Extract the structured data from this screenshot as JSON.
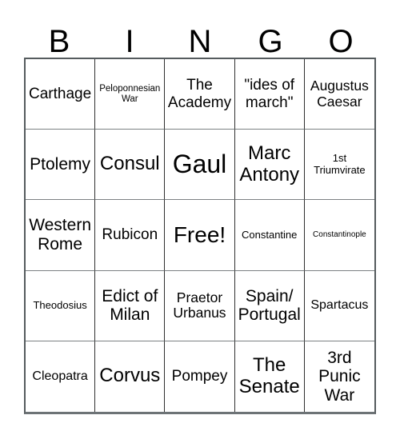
{
  "card": {
    "header_letters": [
      "B",
      "I",
      "N",
      "G",
      "O"
    ],
    "columns": 5,
    "rows": 5,
    "free_space_label": "Free!",
    "free_space_index": 12,
    "grid_border_color": "#555b5e",
    "cell_border_color": "#2f2f2f",
    "background_color": "#ffffff",
    "text_color": "#000000",
    "cells": [
      {
        "label": "Carthage",
        "size": "fs-l"
      },
      {
        "label": "Peloponnesian War",
        "size": "fs-s"
      },
      {
        "label": "The Academy",
        "size": "fs-l"
      },
      {
        "label": "\"ides of march\"",
        "size": "fs-l"
      },
      {
        "label": "Augustus Caesar",
        "size": "fs-ml"
      },
      {
        "label": "Ptolemy",
        "size": "fs-xl"
      },
      {
        "label": "Consul",
        "size": "fs-xxl"
      },
      {
        "label": "Gaul",
        "size": "fs-huge"
      },
      {
        "label": "Marc Antony",
        "size": "fs-xxl"
      },
      {
        "label": "1st Triumvirate",
        "size": "fs-sm"
      },
      {
        "label": "Western Rome",
        "size": "fs-xl"
      },
      {
        "label": "Rubicon",
        "size": "fs-l"
      },
      {
        "label": "Free!",
        "size": "fs-free"
      },
      {
        "label": "Constantine",
        "size": "fs-sm"
      },
      {
        "label": "Constantinople",
        "size": "fs-xs"
      },
      {
        "label": "Theodosius",
        "size": "fs-sm"
      },
      {
        "label": "Edict of Milan",
        "size": "fs-xl"
      },
      {
        "label": "Praetor Urbanus",
        "size": "fs-ml"
      },
      {
        "label": "Spain/ Portugal",
        "size": "fs-xl"
      },
      {
        "label": "Spartacus",
        "size": "fs-m"
      },
      {
        "label": "Cleopatra",
        "size": "fs-m"
      },
      {
        "label": "Corvus",
        "size": "fs-xxl"
      },
      {
        "label": "Pompey",
        "size": "fs-l"
      },
      {
        "label": "The Senate",
        "size": "fs-xxl"
      },
      {
        "label": "3rd Punic War",
        "size": "fs-xl"
      }
    ]
  }
}
